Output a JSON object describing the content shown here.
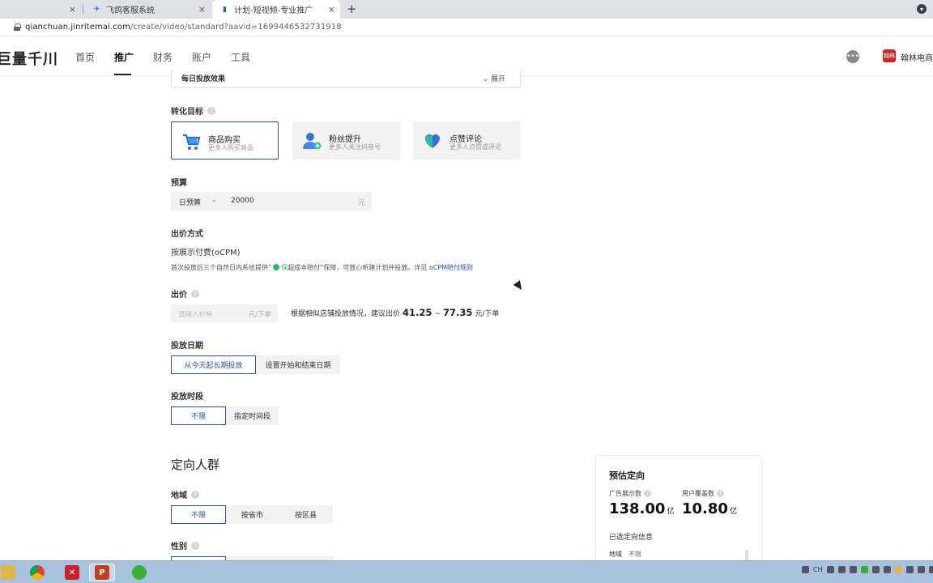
{
  "browser": {
    "tabs": [
      {
        "title": "",
        "close": "×"
      },
      {
        "title": "飞鸽客服系统",
        "close": "×"
      },
      {
        "title": "计划-短视频-专业推广",
        "close": "×"
      }
    ],
    "new_tab": "+",
    "url_host": "qianchuan.jinritemai.com",
    "url_path": "/create/video/standard?aavid=1699446532731918"
  },
  "header": {
    "logo": "巨量千川",
    "nav": [
      {
        "label": "首页"
      },
      {
        "label": "推广"
      },
      {
        "label": "财务"
      },
      {
        "label": "账户"
      },
      {
        "label": "工具"
      }
    ],
    "active_nav": "推广",
    "avatar_text": "翰林",
    "username": "翰林电商"
  },
  "daily_effect": {
    "label": "每日投放效果",
    "expand": "展开"
  },
  "conversion": {
    "label": "转化目标",
    "cards": [
      {
        "title": "商品购买",
        "sub": "更多人购买商品",
        "icon": "cart-icon"
      },
      {
        "title": "粉丝提升",
        "sub": "更多人关注抖音号",
        "icon": "user-plus-icon"
      },
      {
        "title": "点赞评论",
        "sub": "更多人点赞或评论",
        "icon": "heart-icon"
      }
    ],
    "selected": 0
  },
  "budget": {
    "label": "预算",
    "type": "日预算",
    "value": "20000",
    "unit": "元"
  },
  "bid_method": {
    "label": "出价方式",
    "value": "按展示付费(oCPM)",
    "note_pre": "首次投放后三个自然日内系统提供“",
    "note_badge": "保",
    "note_mid": "超成本赔付”保障，可放心新建计划并投放。详见 ",
    "note_link": "oCPM赔付规则"
  },
  "bid": {
    "label": "出价",
    "placeholder": "请输入价格",
    "unit": "元/下单",
    "suggest_pre": "根据相似店铺投放情况，建议出价",
    "suggest_low": "41.25",
    "suggest_sep": "~",
    "suggest_high": "77.35",
    "suggest_unit": "元/下单"
  },
  "date": {
    "label": "投放日期",
    "options": [
      "从今天起长期投放",
      "设置开始和结束日期"
    ],
    "selected": 0
  },
  "time": {
    "label": "投放时段",
    "options": [
      "不限",
      "指定时间段"
    ],
    "selected": 0
  },
  "targeting": {
    "title": "定向人群",
    "region_label": "地域",
    "region_options": [
      "不限",
      "按省市",
      "按区县"
    ],
    "region_selected": 0,
    "gender_label": "性别"
  },
  "estimate": {
    "title": "预估定向",
    "impressions_label": "广告展示数",
    "impressions_value": "138.00",
    "impressions_unit": "亿",
    "coverage_label": "用户覆盖数",
    "coverage_value": "10.80",
    "coverage_unit": "亿",
    "selected_label": "已选定向信息",
    "row_key": "地域",
    "row_val": "不限"
  },
  "taskbar": {
    "tray_text": "CH"
  }
}
